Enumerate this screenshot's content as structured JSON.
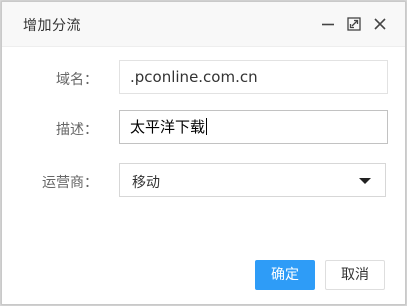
{
  "dialog": {
    "title": "增加分流",
    "controls": {
      "minimize_icon": "minimize-icon",
      "maximize_icon": "maximize-icon",
      "close_icon": "close-icon"
    }
  },
  "form": {
    "domain": {
      "label": "域名：",
      "value": ".pconline.com.cn"
    },
    "description": {
      "label": "描述：",
      "value": "太平洋下载"
    },
    "carrier": {
      "label": "运营商：",
      "selected": "移动"
    }
  },
  "buttons": {
    "ok": "确定",
    "cancel": "取消"
  },
  "colors": {
    "primary_button": "#2e9cf7",
    "titlebar": "#f8f8f8"
  }
}
